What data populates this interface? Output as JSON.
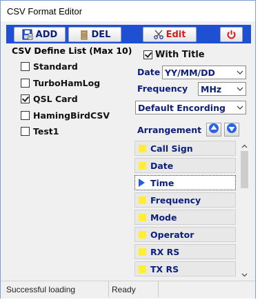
{
  "window": {
    "title": "CSV Format Editor"
  },
  "toolbar": {
    "add_label": "ADD",
    "del_label": "DEL",
    "edit_label": "Edit",
    "accent_color": "#1f4fd3",
    "edit_color": "#d21d1d"
  },
  "define_list": {
    "legend": "CSV Define List (Max 10)",
    "items": [
      {
        "label": "Standard",
        "checked": false
      },
      {
        "label": "TurboHamLog",
        "checked": false
      },
      {
        "label": "QSL Card",
        "checked": true
      },
      {
        "label": "HamingBirdCSV",
        "checked": false
      },
      {
        "label": "Test1",
        "checked": false
      }
    ]
  },
  "options": {
    "with_title_label": "With Title",
    "with_title_checked": true,
    "date_label": "Date",
    "date_value": "YY/MM/DD",
    "frequency_label": "Frequency",
    "frequency_value": "MHz",
    "encoding_value": "Default Encording",
    "arrangement_label": "Arrangement"
  },
  "arrangement": {
    "items": [
      {
        "label": "Call Sign",
        "selected": false
      },
      {
        "label": "Date",
        "selected": false
      },
      {
        "label": "Time",
        "selected": true
      },
      {
        "label": "Frequency",
        "selected": false
      },
      {
        "label": "Mode",
        "selected": false
      },
      {
        "label": "Operator",
        "selected": false
      },
      {
        "label": "RX RS",
        "selected": false
      },
      {
        "label": "TX RS",
        "selected": false
      }
    ]
  },
  "status": {
    "message": "Successful loading",
    "state": "Ready"
  },
  "icons": {
    "add": "save-disk-icon",
    "del": "trash-bin-icon",
    "edit": "scissors-icon",
    "power": "power-icon",
    "move_up": "arrow-up-icon",
    "move_down": "arrow-down-icon"
  }
}
